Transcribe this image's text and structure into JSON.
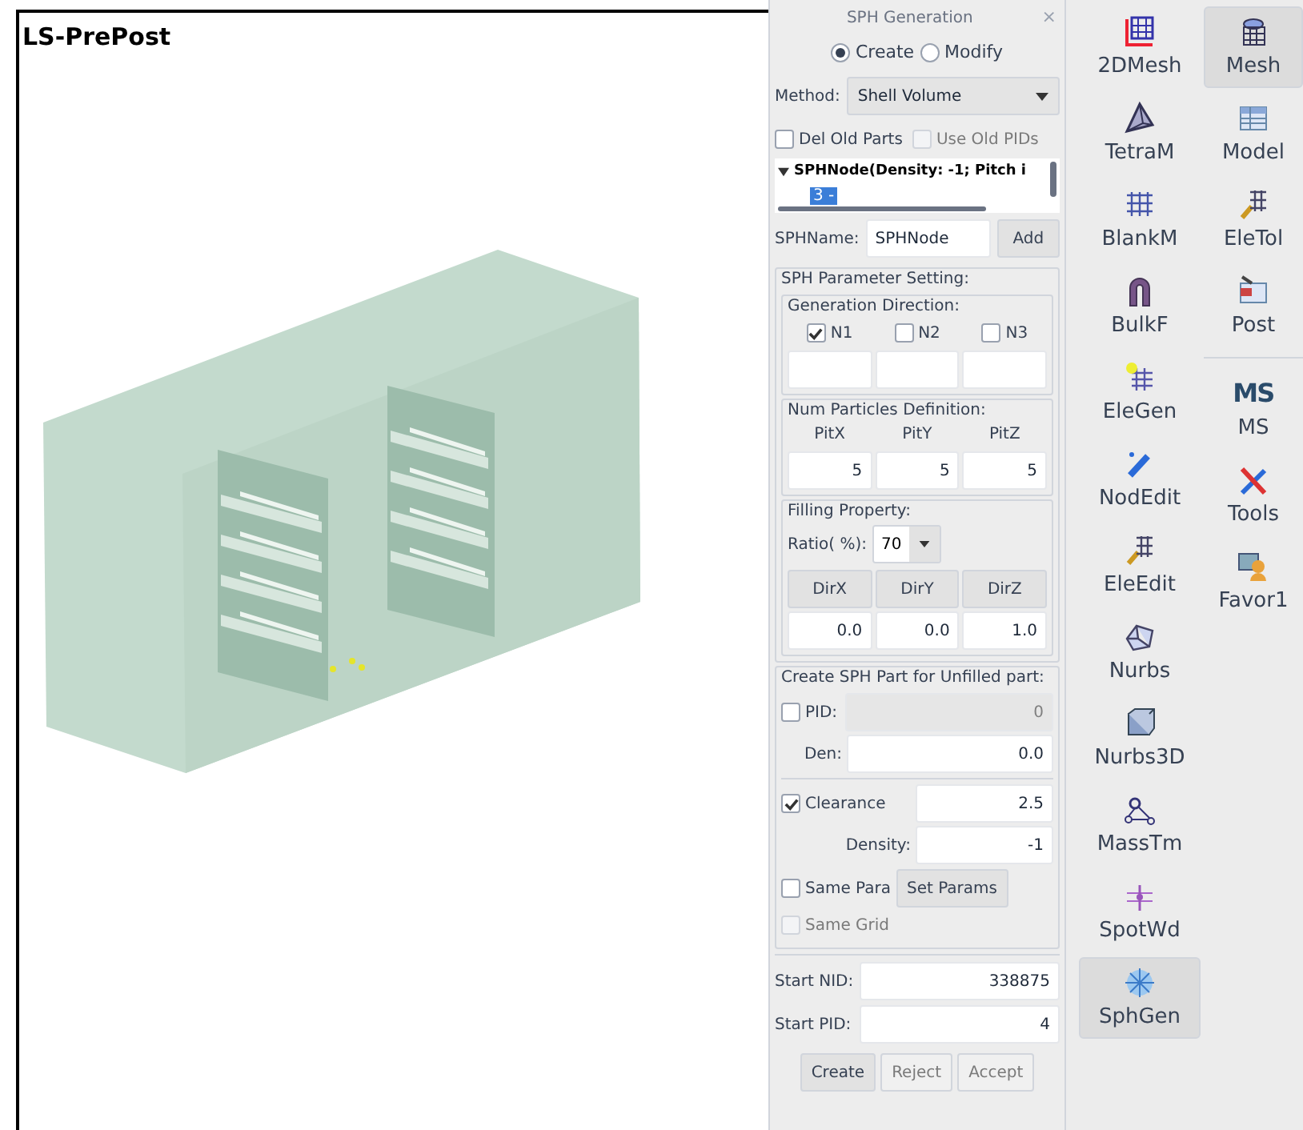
{
  "viewport": {
    "title": "LS-PrePost"
  },
  "dialog": {
    "title": "SPH Generation",
    "close": "×",
    "modes": [
      {
        "label": "Create",
        "selected": true
      },
      {
        "label": "Modify",
        "selected": false
      }
    ],
    "method": {
      "label": "Method:",
      "value": "Shell Volume"
    },
    "options": [
      {
        "label": "Del Old Parts",
        "checked": false,
        "disabled": false
      },
      {
        "label": "Use Old PIDs",
        "checked": false,
        "disabled": true
      }
    ],
    "tree": [
      {
        "label": "SPHNode(Density: -1; Pitch i",
        "expanded": true,
        "children": [
          {
            "label": "3 -",
            "selected": true
          }
        ]
      }
    ],
    "name_field": {
      "label": "SPHName:",
      "value": "SPHNode"
    },
    "add_button": "Add",
    "parameter_setting": {
      "title": "SPH Parameter Setting:",
      "generation_direction": {
        "title": "Generation Direction:",
        "directions": [
          {
            "label": "N1",
            "checked": true
          },
          {
            "label": "N2",
            "checked": false
          },
          {
            "label": "N3",
            "checked": false
          }
        ]
      },
      "num_particles": {
        "title": "Num Particles Definition:",
        "columns": [
          {
            "label": "PitX",
            "value": "5"
          },
          {
            "label": "PitY",
            "value": "5"
          },
          {
            "label": "PitZ",
            "value": "5"
          }
        ]
      },
      "filling": {
        "title": "Filling Property:",
        "ratio_label": "Ratio( %):",
        "ratio": "70",
        "directions": [
          {
            "label": "DirX",
            "value": "0.0"
          },
          {
            "label": "DirY",
            "value": "0.0"
          },
          {
            "label": "DirZ",
            "value": "1.0"
          }
        ]
      }
    },
    "unfilled": {
      "title": "Create SPH Part for Unfilled part:",
      "pid": {
        "label": "PID:",
        "checked": false,
        "value": "0"
      },
      "den": {
        "label": "Den:",
        "value": "0.0"
      },
      "clearance": {
        "label": "Clearance",
        "checked": true,
        "value": "2.5"
      },
      "density": {
        "label": "Density:",
        "value": "-1"
      },
      "same_para": {
        "label": "Same Para",
        "checked": false
      },
      "set_params": "Set Params",
      "same_grid": {
        "label": "Same Grid",
        "checked": false,
        "disabled": true
      }
    },
    "start_nid": {
      "label": "Start NID:",
      "value": "338875"
    },
    "start_pid": {
      "label": "Start PID:",
      "value": "4"
    },
    "actions": [
      {
        "label": "Create",
        "disabled": false
      },
      {
        "label": "Reject",
        "disabled": true
      },
      {
        "label": "Accept",
        "disabled": true
      }
    ]
  },
  "toolbar": {
    "columns": [
      {
        "groups": [
          [
            {
              "label": "2DMesh",
              "kind": "grid2d",
              "selected": false
            },
            {
              "label": "TetraM",
              "kind": "tetra",
              "selected": false
            },
            {
              "label": "BlankM",
              "kind": "dots",
              "selected": false
            },
            {
              "label": "BulkF",
              "kind": "arch",
              "selected": false
            },
            {
              "label": "EleGen",
              "kind": "spark",
              "selected": false
            },
            {
              "label": "NodEdit",
              "kind": "pen",
              "selected": false
            },
            {
              "label": "EleEdit",
              "kind": "wand",
              "selected": false
            },
            {
              "label": "Nurbs",
              "kind": "surface",
              "selected": false
            },
            {
              "label": "Nurbs3D",
              "kind": "cube",
              "selected": false
            },
            {
              "label": "MassTm",
              "kind": "nodes",
              "selected": false
            },
            {
              "label": "SpotWd",
              "kind": "weld",
              "selected": false
            },
            {
              "label": "SphGen",
              "kind": "snow",
              "selected": true
            }
          ]
        ]
      },
      {
        "groups": [
          [
            {
              "label": "Mesh",
              "kind": "mesh",
              "selected": true
            },
            {
              "label": "Model",
              "kind": "table",
              "selected": false
            },
            {
              "label": "EleTol",
              "kind": "wand",
              "selected": false
            },
            {
              "label": "Post",
              "kind": "window",
              "selected": false
            }
          ],
          [
            {
              "label": "MS",
              "kind": "text",
              "glyph": "MS",
              "selected": false
            },
            {
              "label": "Tools",
              "kind": "tools",
              "selected": false
            },
            {
              "label": "Favor1",
              "kind": "users",
              "selected": false
            }
          ]
        ]
      }
    ]
  }
}
